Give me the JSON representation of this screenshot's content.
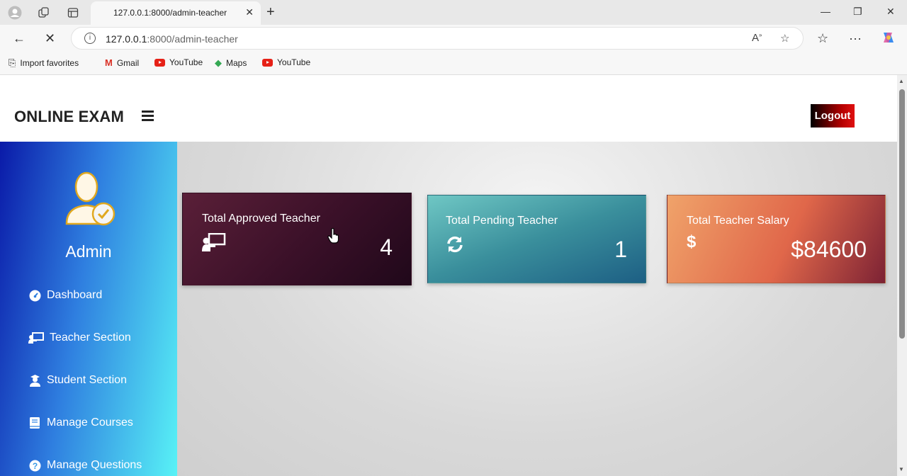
{
  "browser": {
    "tab_title": "127.0.0.1:8000/admin-teacher",
    "url_host": "127.0.0.1",
    "url_rest": ":8000/admin-teacher",
    "favorites": [
      "Import favorites",
      "Gmail",
      "YouTube",
      "Maps",
      "YouTube"
    ]
  },
  "header": {
    "brand": "ONLINE EXAM",
    "logout_label": "Logout"
  },
  "sidebar": {
    "user_name": "Admin",
    "items": [
      {
        "label": "Dashboard",
        "icon": "tachometer-icon"
      },
      {
        "label": "Teacher Section",
        "icon": "chalkboard-teacher-icon"
      },
      {
        "label": "Student Section",
        "icon": "user-graduate-icon"
      },
      {
        "label": "Manage Courses",
        "icon": "book-icon"
      },
      {
        "label": "Manage Questions",
        "icon": "question-circle-icon"
      }
    ]
  },
  "cards": [
    {
      "title": "Total Approved Teacher",
      "value": "4",
      "icon": "chalkboard-teacher-icon",
      "color_from": "#5a1f38",
      "color_to": "#20081a"
    },
    {
      "title": "Total Pending Teacher",
      "value": "1",
      "icon": "sync-icon",
      "color_from": "#6fc7c4",
      "color_to": "#1d5f84"
    },
    {
      "title": "Total Teacher Salary",
      "value": "$84600",
      "icon": "dollar-icon",
      "color_from": "#f0a36a",
      "color_to": "#7c2234"
    }
  ]
}
